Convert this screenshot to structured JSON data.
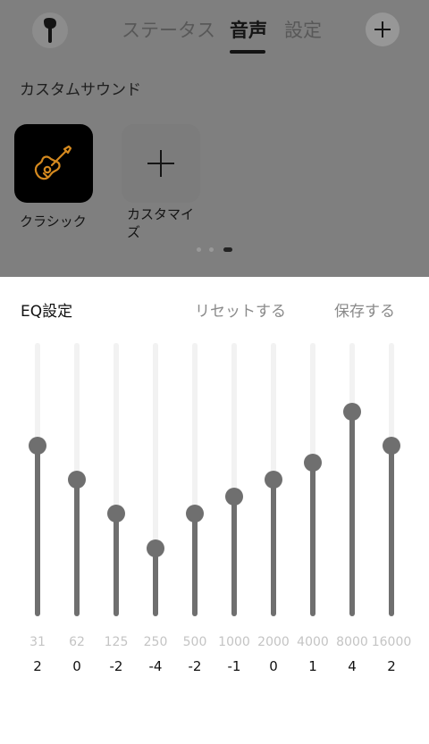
{
  "header": {
    "tabs": [
      {
        "label": "ステータス",
        "active": false
      },
      {
        "label": "音声",
        "active": true
      },
      {
        "label": "設定",
        "active": false
      }
    ],
    "device_icon": "earbud-icon",
    "add_icon": "plus-icon"
  },
  "custom_sound": {
    "title": "カスタムサウンド",
    "presets": [
      {
        "label": "クラシック",
        "icon": "guitar-icon",
        "accent": "#d4891f"
      },
      {
        "label": "カスタマイズ",
        "icon": "plus-icon"
      }
    ],
    "page_dots": {
      "count": 3,
      "active_index": 2
    }
  },
  "eq": {
    "title": "EQ設定",
    "reset_label": "リセットする",
    "save_label": "保存する",
    "range": [
      -8,
      8
    ],
    "bands": [
      {
        "freq": "31",
        "gain": 2
      },
      {
        "freq": "62",
        "gain": 0
      },
      {
        "freq": "125",
        "gain": -2
      },
      {
        "freq": "250",
        "gain": -4
      },
      {
        "freq": "500",
        "gain": -2
      },
      {
        "freq": "1000",
        "gain": -1
      },
      {
        "freq": "2000",
        "gain": 0
      },
      {
        "freq": "4000",
        "gain": 1
      },
      {
        "freq": "8000",
        "gain": 4
      },
      {
        "freq": "16000",
        "gain": 2
      }
    ]
  },
  "colors": {
    "overlay": "#7f7f7f",
    "slider_fill": "#6f6f6f",
    "slider_track": "#f2f2f2"
  }
}
